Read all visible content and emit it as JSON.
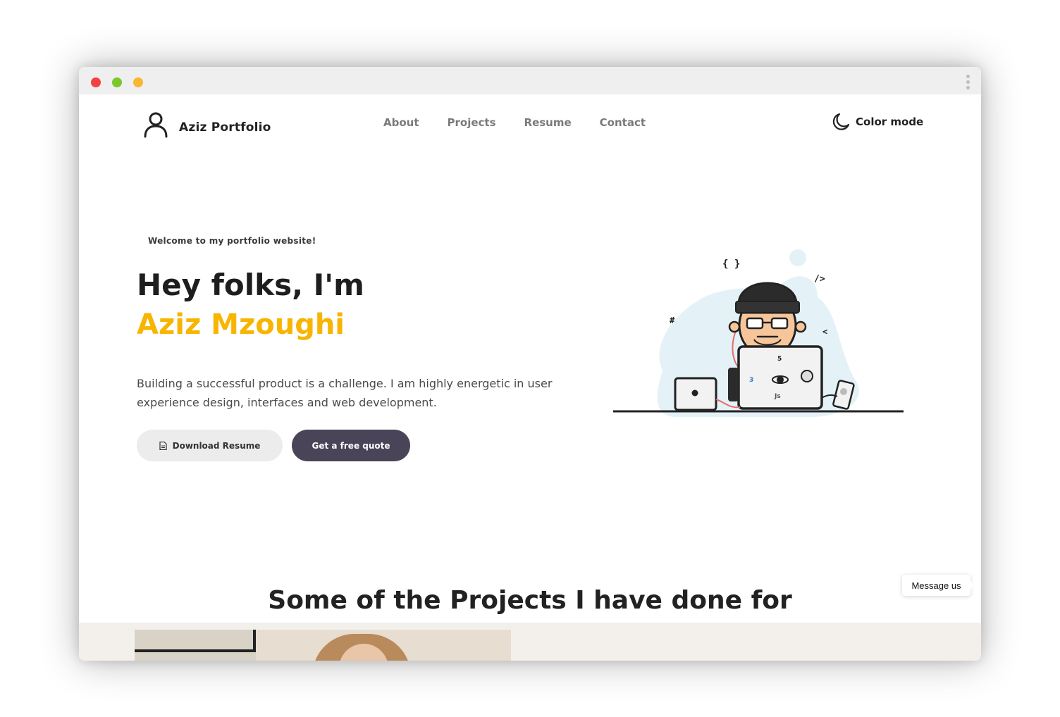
{
  "brand": {
    "name": "Aziz Portfolio",
    "icon": "user-icon"
  },
  "nav": {
    "items": [
      "About",
      "Projects",
      "Resume",
      "Contact"
    ]
  },
  "color_mode": {
    "label": "Color mode",
    "icon": "moon-icon"
  },
  "hero": {
    "welcome": "Welcome to my portfolio website!",
    "line1": "Hey folks, I'm",
    "name": "Aziz Mzoughi",
    "description": "Building a successful product is a challenge. I am highly energetic in user experience design, interfaces and web development.",
    "download_button": "Download Resume",
    "quote_button": "Get a free quote",
    "illustration_labels": {
      "braces": "{ }",
      "tag": "/>",
      "hash": "#",
      "chevron": "<",
      "css": "3",
      "html": "5",
      "js": "Js"
    }
  },
  "projects": {
    "title": "Some of the Projects I have done for"
  },
  "chat": {
    "label": "Message us"
  },
  "colors": {
    "accent": "#f7b500",
    "button_dark": "#4a4459",
    "illustration_blob": "#e4f2f8"
  }
}
